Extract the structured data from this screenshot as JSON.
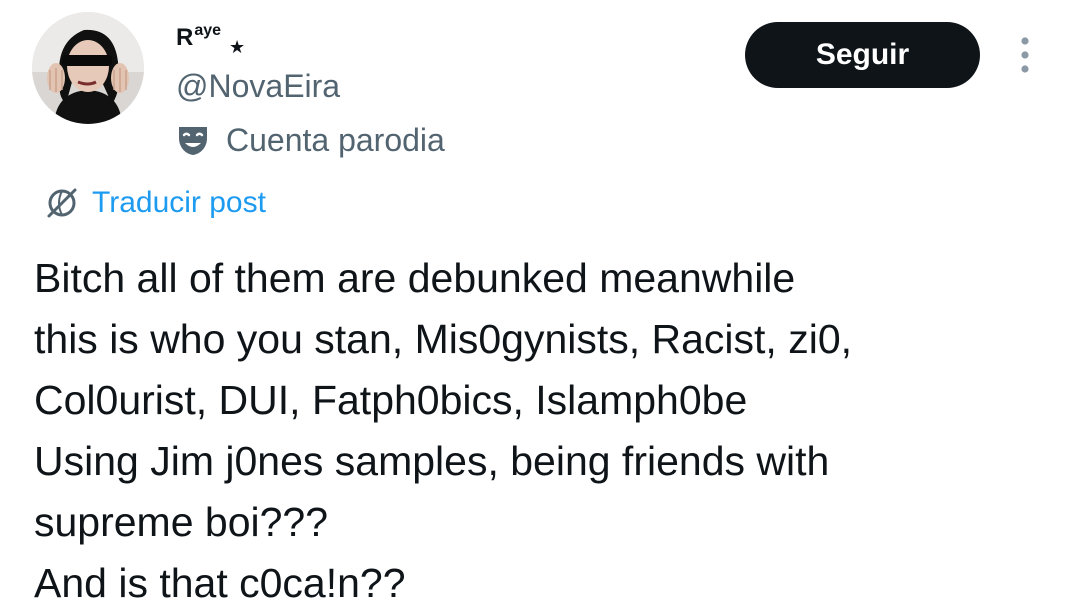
{
  "author": {
    "name_initial": "R",
    "name_rest": "aye",
    "name_symbol": "★",
    "handle": "@NovaEira",
    "badge_label": "Cuenta parodia",
    "badge_icon": "theater-mask-icon",
    "avatar_icon": "profile-photo-avatar"
  },
  "actions": {
    "follow_label": "Seguir",
    "more_icon": "more-vertical-icon"
  },
  "translate": {
    "label": "Traducir post",
    "icon": "globe-icon"
  },
  "post": {
    "text": "Bitch all of them are debunked meanwhile\nthis is who you stan, Mis0gynists, Racist, zi0,\nCol0urist, DUI, Fatph0bics, Islamph0be\nUsing Jim j0nes samples, being friends with\nsupreme boi???\nAnd is that c0ca!n??"
  },
  "colors": {
    "text": "#0f1419",
    "secondary": "#536471",
    "link": "#1d9bf0",
    "follow_bg": "#0f1419"
  }
}
